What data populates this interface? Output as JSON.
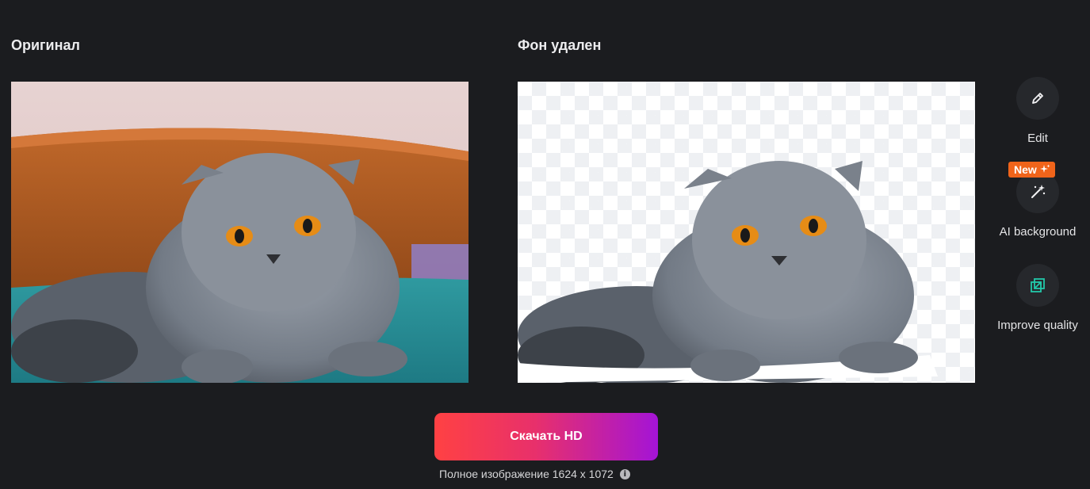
{
  "panels": {
    "original_title": "Оригинал",
    "removed_title": "Фон удален"
  },
  "tools": {
    "edit_label": "Edit",
    "ai_background_label": "AI background",
    "ai_badge": "New",
    "improve_label": "Improve quality"
  },
  "download": {
    "label": "Скачать HD",
    "full_size_text": "Полное изображение 1624 x 1072"
  },
  "colors": {
    "background": "#1b1c1f",
    "button_gradient_start": "#ff4143",
    "button_gradient_end": "#a414d6",
    "badge": "#f0641a",
    "improve_icon": "#22c7a9"
  },
  "icons": {
    "edit": "pencil-icon",
    "ai_background": "magic-wand-icon",
    "badge": "sparkle-icon",
    "improve": "enhance-icon",
    "info": "info-icon"
  }
}
